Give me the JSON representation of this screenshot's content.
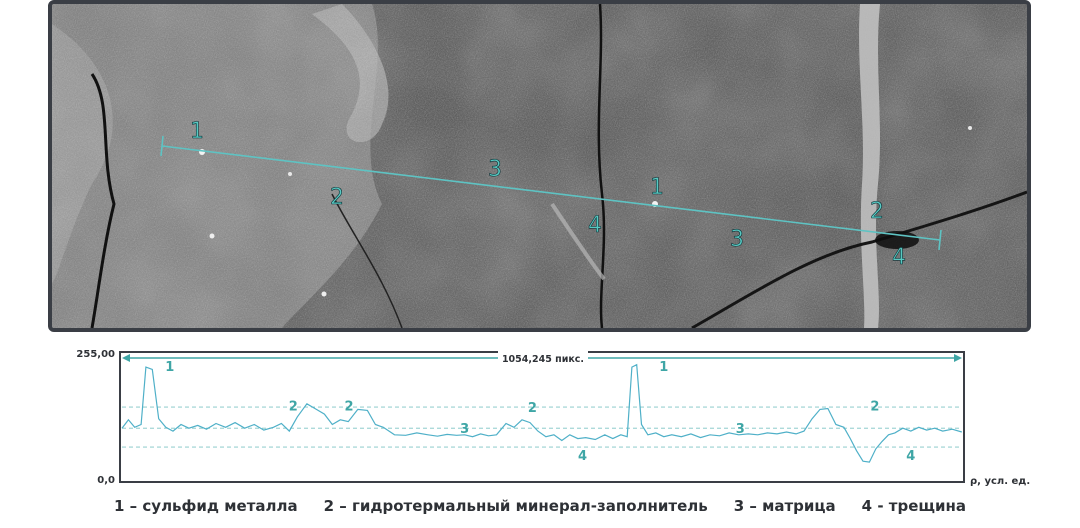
{
  "image": {
    "markers": [
      {
        "label": "1"
      },
      {
        "label": "2"
      },
      {
        "label": "3"
      },
      {
        "label": "4"
      },
      {
        "label": "1"
      },
      {
        "label": "3"
      },
      {
        "label": "2"
      },
      {
        "label": "4"
      }
    ]
  },
  "chart_data": {
    "type": "line",
    "ylim": [
      0,
      255
    ],
    "y_tick_labels": [
      "255,00",
      "0,0"
    ],
    "xlabel": "ρ, усл. ед.",
    "span_label": "1054,245 пикс.",
    "x_range": [
      0,
      1054.245
    ],
    "reference_levels": [
      155,
      110,
      70
    ],
    "series": [
      {
        "points": [
          [
            0,
            110
          ],
          [
            8,
            128
          ],
          [
            16,
            112
          ],
          [
            24,
            118
          ],
          [
            30,
            240
          ],
          [
            38,
            235
          ],
          [
            46,
            130
          ],
          [
            55,
            112
          ],
          [
            64,
            104
          ],
          [
            74,
            118
          ],
          [
            84,
            110
          ],
          [
            95,
            116
          ],
          [
            106,
            108
          ],
          [
            118,
            120
          ],
          [
            130,
            112
          ],
          [
            142,
            122
          ],
          [
            154,
            110
          ],
          [
            166,
            118
          ],
          [
            178,
            106
          ],
          [
            190,
            112
          ],
          [
            200,
            120
          ],
          [
            210,
            104
          ],
          [
            220,
            134
          ],
          [
            232,
            162
          ],
          [
            244,
            150
          ],
          [
            254,
            140
          ],
          [
            264,
            118
          ],
          [
            274,
            128
          ],
          [
            284,
            124
          ],
          [
            296,
            150
          ],
          [
            308,
            148
          ],
          [
            318,
            118
          ],
          [
            328,
            112
          ],
          [
            342,
            96
          ],
          [
            356,
            95
          ],
          [
            370,
            100
          ],
          [
            384,
            96
          ],
          [
            396,
            93
          ],
          [
            408,
            97
          ],
          [
            420,
            95
          ],
          [
            430,
            96
          ],
          [
            440,
            92
          ],
          [
            450,
            98
          ],
          [
            460,
            94
          ],
          [
            470,
            96
          ],
          [
            482,
            120
          ],
          [
            492,
            112
          ],
          [
            502,
            128
          ],
          [
            512,
            122
          ],
          [
            522,
            104
          ],
          [
            532,
            92
          ],
          [
            542,
            96
          ],
          [
            552,
            84
          ],
          [
            562,
            96
          ],
          [
            572,
            88
          ],
          [
            582,
            90
          ],
          [
            594,
            86
          ],
          [
            606,
            96
          ],
          [
            616,
            88
          ],
          [
            626,
            96
          ],
          [
            634,
            92
          ],
          [
            640,
            240
          ],
          [
            646,
            245
          ],
          [
            652,
            118
          ],
          [
            660,
            96
          ],
          [
            670,
            100
          ],
          [
            680,
            92
          ],
          [
            690,
            96
          ],
          [
            702,
            92
          ],
          [
            714,
            98
          ],
          [
            726,
            90
          ],
          [
            738,
            96
          ],
          [
            750,
            94
          ],
          [
            762,
            100
          ],
          [
            774,
            96
          ],
          [
            786,
            98
          ],
          [
            798,
            96
          ],
          [
            810,
            100
          ],
          [
            822,
            98
          ],
          [
            834,
            102
          ],
          [
            846,
            98
          ],
          [
            856,
            104
          ],
          [
            866,
            130
          ],
          [
            876,
            150
          ],
          [
            886,
            152
          ],
          [
            896,
            118
          ],
          [
            906,
            112
          ],
          [
            914,
            88
          ],
          [
            922,
            62
          ],
          [
            930,
            40
          ],
          [
            938,
            38
          ],
          [
            946,
            66
          ],
          [
            954,
            82
          ],
          [
            962,
            96
          ],
          [
            970,
            100
          ],
          [
            980,
            110
          ],
          [
            990,
            104
          ],
          [
            1000,
            112
          ],
          [
            1010,
            106
          ],
          [
            1020,
            110
          ],
          [
            1030,
            104
          ],
          [
            1042,
            108
          ],
          [
            1054,
            102
          ]
        ]
      }
    ],
    "annotations": [
      {
        "text": "1",
        "x": 60,
        "y": 232
      },
      {
        "text": "1",
        "x": 680,
        "y": 232
      },
      {
        "text": "2",
        "x": 215,
        "y": 148
      },
      {
        "text": "2",
        "x": 285,
        "y": 148
      },
      {
        "text": "2",
        "x": 515,
        "y": 145
      },
      {
        "text": "2",
        "x": 945,
        "y": 148
      },
      {
        "text": "3",
        "x": 430,
        "y": 100
      },
      {
        "text": "3",
        "x": 776,
        "y": 100
      },
      {
        "text": "4",
        "x": 578,
        "y": 42
      },
      {
        "text": "4",
        "x": 990,
        "y": 42
      }
    ]
  },
  "legend": {
    "items": [
      "1 – сульфид металла",
      "2 – гидротермальный минерал-заполнитель",
      "3 – матрица",
      "4 - трещина"
    ]
  },
  "colors": {
    "teal": "#3fa6a6",
    "trace": "#4fb0c8",
    "frame": "#3a3e45"
  }
}
